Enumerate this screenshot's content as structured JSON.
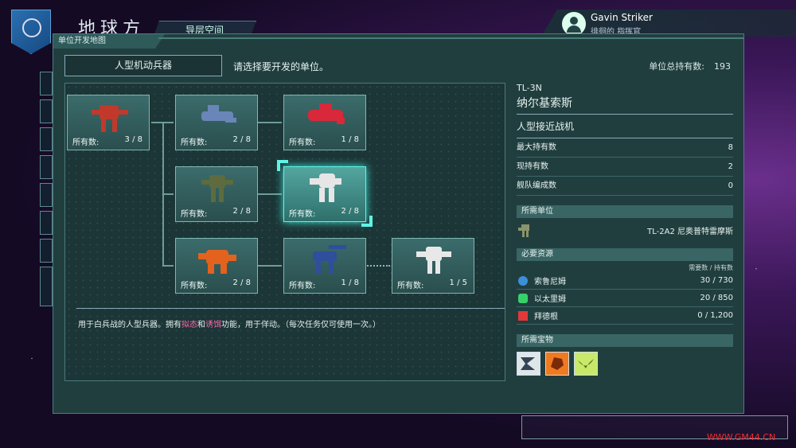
{
  "header": {
    "game_title": "地球方",
    "sub_tab": "导层空间"
  },
  "profile": {
    "name": "Gavin Striker",
    "rank": "徘徊的 指挥官"
  },
  "panel": {
    "title": "单位开发地图",
    "category": "人型机动兵器",
    "instruction": "请选择要开发的单位。",
    "total_label": "单位总持有数:",
    "total_value": "193"
  },
  "tree": {
    "nodes": [
      {
        "label": "所有数:",
        "count": "3 / 8",
        "color": "#c0392b"
      },
      {
        "label": "所有数:",
        "count": "2 / 8",
        "color": "#6a86b8"
      },
      {
        "label": "所有数:",
        "count": "1 / 8",
        "color": "#d8283a"
      },
      {
        "label": "所有数:",
        "count": "2 / 8",
        "color": "#5d6b3e"
      },
      {
        "label": "所有数:",
        "count": "2 / 8",
        "color": "#e6e6e6"
      },
      {
        "label": "所有数:",
        "count": "2 / 8",
        "color": "#e2621e"
      },
      {
        "label": "所有数:",
        "count": "1 / 8",
        "color": "#2f4e9c"
      },
      {
        "label": "所有数:",
        "count": "1 / 5",
        "color": "#e8e8e8"
      }
    ],
    "description_prefix": "用于白兵战的人型兵器。拥有",
    "hl1": "拟态",
    "description_mid": "和",
    "hl2": "诱饵",
    "description_suffix": "功能，用于佯动。（每次任务仅可使用一次。）"
  },
  "detail": {
    "code": "TL-3N",
    "name": "纳尔基索斯",
    "type": "人型接近战机",
    "stats": [
      {
        "label": "最大持有数",
        "value": "8"
      },
      {
        "label": "现持有数",
        "value": "2"
      },
      {
        "label": "舰队编成数",
        "value": "0"
      }
    ],
    "required_unit_header": "所需单位",
    "required_unit": "TL-2A2  尼奥普特雷摩斯",
    "resources_header": "必要资源",
    "resources_col": "需要数 / 持有数",
    "resources": [
      {
        "name": "索鲁尼姆",
        "value": "30 / 730",
        "color": "#3a8fd8"
      },
      {
        "name": "以太里姆",
        "value": "20 / 850",
        "color": "#37d16a"
      },
      {
        "name": "拜德根",
        "value": "0 / 1,200",
        "color": "#e23838"
      }
    ],
    "treasures_header": "所需宝物"
  },
  "watermark": "WWW.GM44.CN"
}
